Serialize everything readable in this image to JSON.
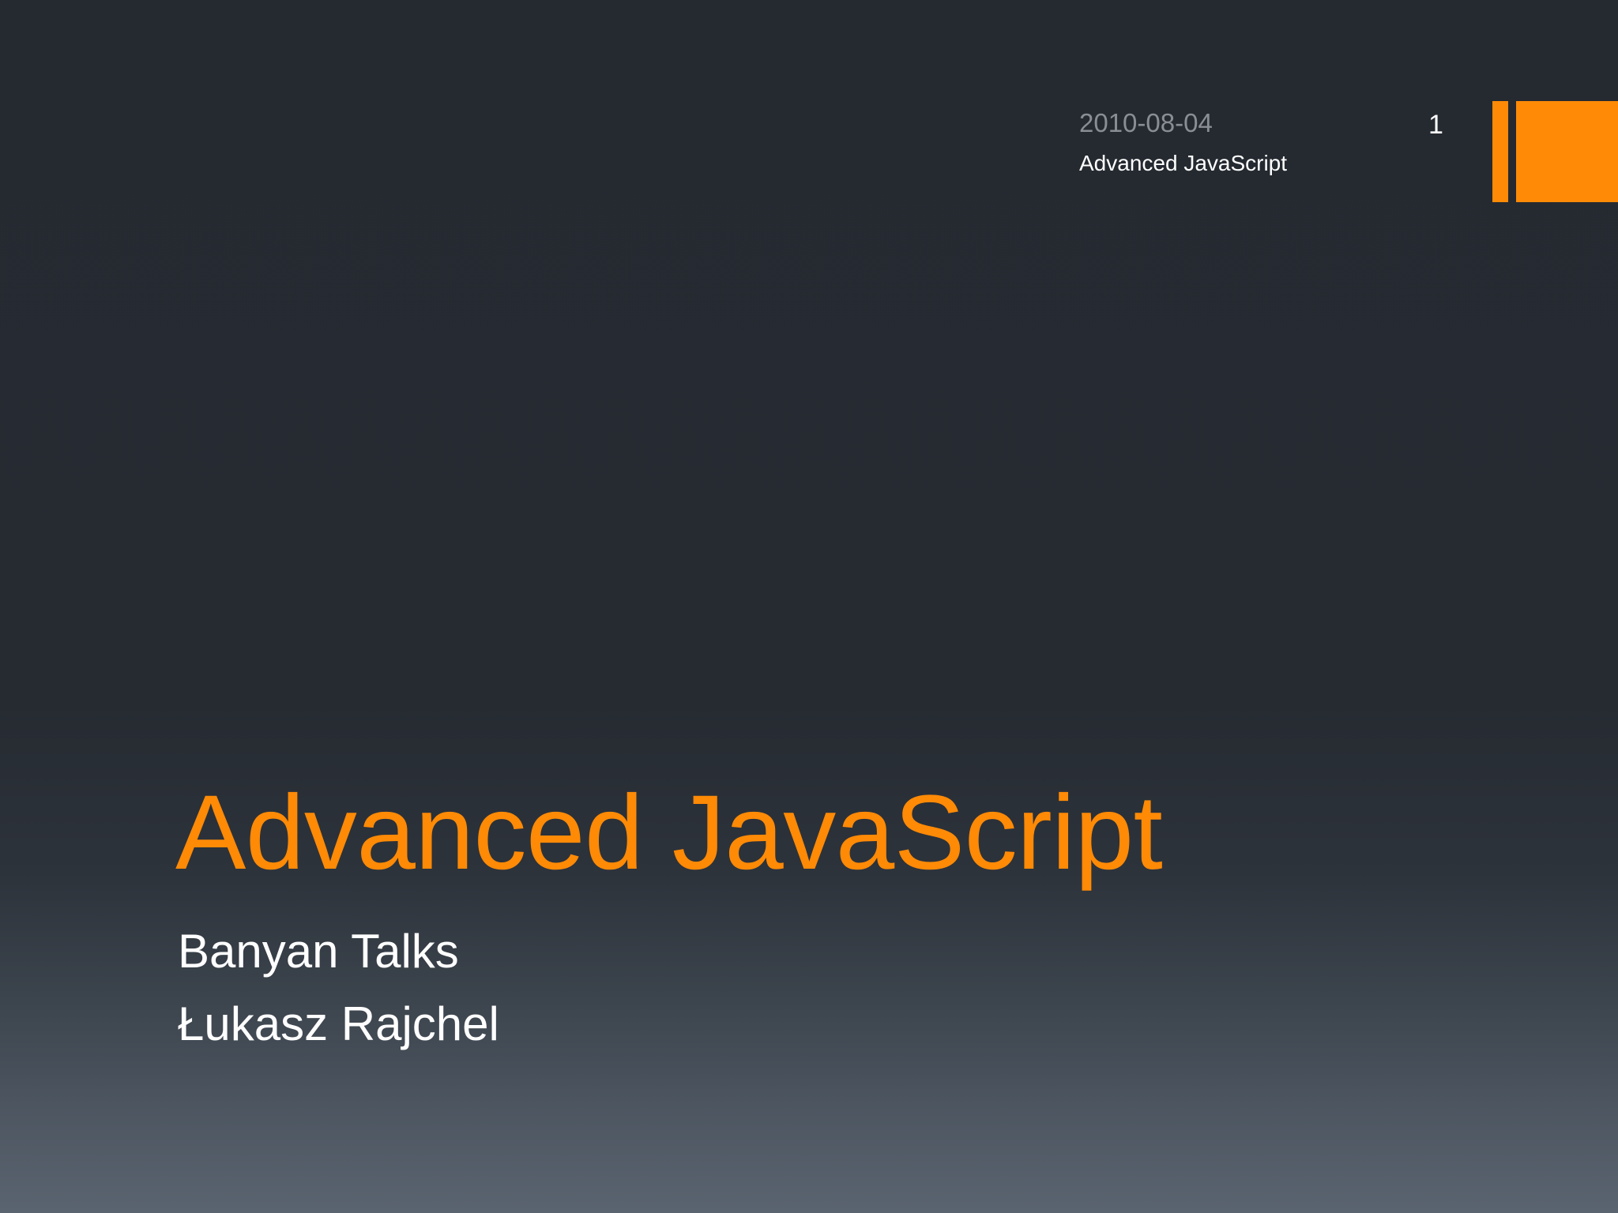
{
  "colors": {
    "accent": "#ff8a06",
    "text": "#ffffff",
    "muted": "#8a8e94"
  },
  "header": {
    "date": "2010-08-04",
    "footer_title": "Advanced JavaScript",
    "slide_number": "1"
  },
  "title": {
    "text": "Advanced JavaScript"
  },
  "subtitle": {
    "lines": [
      "Banyan Talks",
      "Łukasz Rajchel"
    ]
  }
}
